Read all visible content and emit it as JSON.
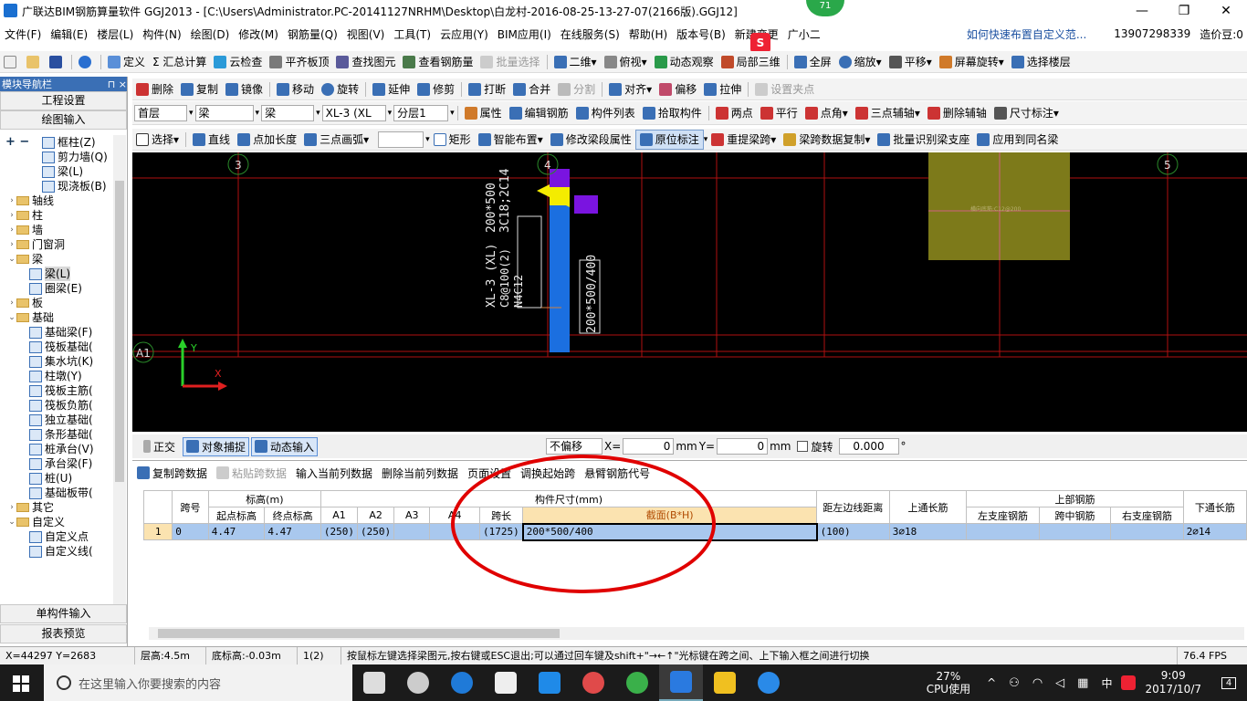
{
  "window": {
    "title": "广联达BIM钢筋算量软件 GGJ2013 - [C:\\Users\\Administrator.PC-20141127NRHM\\Desktop\\白龙村-2016-08-25-13-27-07(2166版).GGJ12]",
    "badge": "71",
    "min": "—",
    "max": "❐",
    "close": "✕"
  },
  "menu": [
    "文件(F)",
    "编辑(E)",
    "楼层(L)",
    "构件(N)",
    "绘图(D)",
    "修改(M)",
    "钢筋量(Q)",
    "视图(V)",
    "工具(T)",
    "云应用(Y)",
    "BIM应用(I)",
    "在线服务(S)",
    "帮助(H)",
    "版本号(B)",
    "新建变更",
    "广小二"
  ],
  "menu_right": {
    "link": "如何快速布置自定义范...",
    "phone": "13907298339",
    "price": "造价豆:0"
  },
  "toolbar1": [
    "定义",
    "Σ 汇总计算",
    "云检查",
    "平齐板顶",
    "查找图元",
    "查看钢筋量",
    "批量选择",
    "二维",
    "俯视",
    "动态观察",
    "局部三维",
    "全屏",
    "缩放",
    "平移",
    "屏幕旋转",
    "选择楼层"
  ],
  "toolbar2": [
    "删除",
    "复制",
    "镜像",
    "移动",
    "旋转",
    "延伸",
    "修剪",
    "打断",
    "合并",
    "分割",
    "对齐",
    "偏移",
    "拉伸",
    "设置夹点"
  ],
  "toolbar3": {
    "floor": "首层",
    "cat": "梁",
    "type": "梁",
    "member": "XL-3 (XL",
    "layer": "分层1",
    "items": [
      "属性",
      "编辑钢筋",
      "构件列表",
      "拾取构件",
      "两点",
      "平行",
      "点角",
      "三点辅轴",
      "删除辅轴",
      "尺寸标注"
    ]
  },
  "toolbar4": [
    "选择",
    "直线",
    "点加长度",
    "三点画弧",
    "矩形",
    "智能布置",
    "修改梁段属性",
    "原位标注",
    "重提梁跨",
    "梁跨数据复制",
    "批量识别梁支座",
    "应用到同名梁"
  ],
  "leftpanel": {
    "title": "模块导航栏",
    "pin": "⊓ ×",
    "btn1": "工程设置",
    "btn2": "绘图输入",
    "btn3": "单构件输入",
    "btn4": "报表预览",
    "plusminus": "+ −",
    "tree": [
      {
        "label": "框柱(Z)",
        "lvl": 2,
        "leaf": true
      },
      {
        "label": "剪力墙(Q)",
        "lvl": 2,
        "leaf": true
      },
      {
        "label": "梁(L)",
        "lvl": 2,
        "leaf": true
      },
      {
        "label": "现浇板(B)",
        "lvl": 2,
        "leaf": true
      },
      {
        "label": "轴线",
        "lvl": 0,
        "exp": "›"
      },
      {
        "label": "柱",
        "lvl": 0,
        "exp": "›"
      },
      {
        "label": "墙",
        "lvl": 0,
        "exp": "›"
      },
      {
        "label": "门窗洞",
        "lvl": 0,
        "exp": "›"
      },
      {
        "label": "梁",
        "lvl": 0,
        "exp": "⌄"
      },
      {
        "label": "梁(L)",
        "lvl": 1,
        "leaf": true,
        "sel": true
      },
      {
        "label": "圈梁(E)",
        "lvl": 1,
        "leaf": true
      },
      {
        "label": "板",
        "lvl": 0,
        "exp": "›"
      },
      {
        "label": "基础",
        "lvl": 0,
        "exp": "⌄"
      },
      {
        "label": "基础梁(F)",
        "lvl": 1,
        "leaf": true
      },
      {
        "label": "筏板基础(",
        "lvl": 1,
        "leaf": true
      },
      {
        "label": "集水坑(K)",
        "lvl": 1,
        "leaf": true
      },
      {
        "label": "柱墩(Y)",
        "lvl": 1,
        "leaf": true
      },
      {
        "label": "筏板主筋(",
        "lvl": 1,
        "leaf": true
      },
      {
        "label": "筏板负筋(",
        "lvl": 1,
        "leaf": true
      },
      {
        "label": "独立基础(",
        "lvl": 1,
        "leaf": true
      },
      {
        "label": "条形基础(",
        "lvl": 1,
        "leaf": true
      },
      {
        "label": "桩承台(V)",
        "lvl": 1,
        "leaf": true
      },
      {
        "label": "承台梁(F)",
        "lvl": 1,
        "leaf": true
      },
      {
        "label": "桩(U)",
        "lvl": 1,
        "leaf": true
      },
      {
        "label": "基础板带(",
        "lvl": 1,
        "leaf": true
      },
      {
        "label": "其它",
        "lvl": 0,
        "exp": "›"
      },
      {
        "label": "自定义",
        "lvl": 0,
        "exp": "⌄"
      },
      {
        "label": "自定义点",
        "lvl": 1,
        "leaf": true
      },
      {
        "label": "自定义线(",
        "lvl": 1,
        "leaf": true
      }
    ]
  },
  "canvas": {
    "axis3": "3",
    "axis4": "4",
    "axis5": "5",
    "axisA1": "A1",
    "label1": "200*500",
    "label2": "3C18;2C14",
    "label3": "XL-3 (XL)",
    "label4": "C8@100(2)",
    "label5": "N4C12",
    "label6": "200*500/400",
    "ax_y": "Y",
    "ax_x": "X",
    "padlabel": "横向底筋:C12@200"
  },
  "coordbar": {
    "ortho": "正交",
    "snap": "对象捕捉",
    "dyn": "动态输入",
    "offset": "不偏移",
    "xlabel": "X=",
    "x": "0",
    "ylabel": "Y=",
    "y": "0",
    "mm": "mm",
    "rot": "旋转",
    "angle": "0.000",
    "deg": "°"
  },
  "bottomtool": [
    "复制跨数据",
    "粘贴跨数据",
    "输入当前列数据",
    "删除当前列数据",
    "页面设置",
    "调换起始跨",
    "悬臂钢筋代号"
  ],
  "grid": {
    "h_span": "跨号",
    "h_elev": "标高(m)",
    "h_start": "起点标高",
    "h_end": "终点标高",
    "h_size": "构件尺寸(mm)",
    "h_a1": "A1",
    "h_a2": "A2",
    "h_a3": "A3",
    "h_a4": "A4",
    "h_len": "跨长",
    "h_sec": "截面(B*H)",
    "h_dist": "距左边线距离",
    "h_top": "上通长筋",
    "h_upper": "上部钢筋",
    "h_left": "左支座钢筋",
    "h_mid": "跨中钢筋",
    "h_right": "右支座钢筋",
    "h_bottom": "下通长筋",
    "row": {
      "no": "1",
      "span": "0",
      "start": "4.47",
      "end": "4.47",
      "a1": "(250)",
      "a2": "(250)",
      "a3": "",
      "a4": "",
      "len": "(1725)",
      "sec": "200*500/400",
      "dist": "(100)",
      "top": "3⌀18",
      "left": "",
      "mid": "",
      "right": "",
      "bottom": "2⌀14"
    }
  },
  "status": {
    "coord": "X=44297 Y=2683",
    "floorh": "层高:4.5m",
    "base": "底标高:-0.03m",
    "count": "1(2)",
    "hint": "按鼠标左键选择梁图元,按右键或ESC退出;可以通过回车键及shift+\"→←↑\"光标键在跨之间、上下输入框之间进行切换",
    "fps": "76.4 FPS"
  },
  "taskbar": {
    "search": "在这里输入你要搜索的内容",
    "cpu": "27%",
    "cpulabel": "CPU使用",
    "ime": "中",
    "time": "9:09",
    "date": "2017/10/7",
    "notif": "4"
  },
  "colors": {
    "canvas": "#000000",
    "axisline": "#b01010",
    "beam": "#1b6fe0",
    "pad": "#7d7a1a",
    "yellow": "#f4ec00",
    "purple": "#7a14e0",
    "ellipse": "#e00000",
    "rowsel": "#a9c8ee"
  }
}
